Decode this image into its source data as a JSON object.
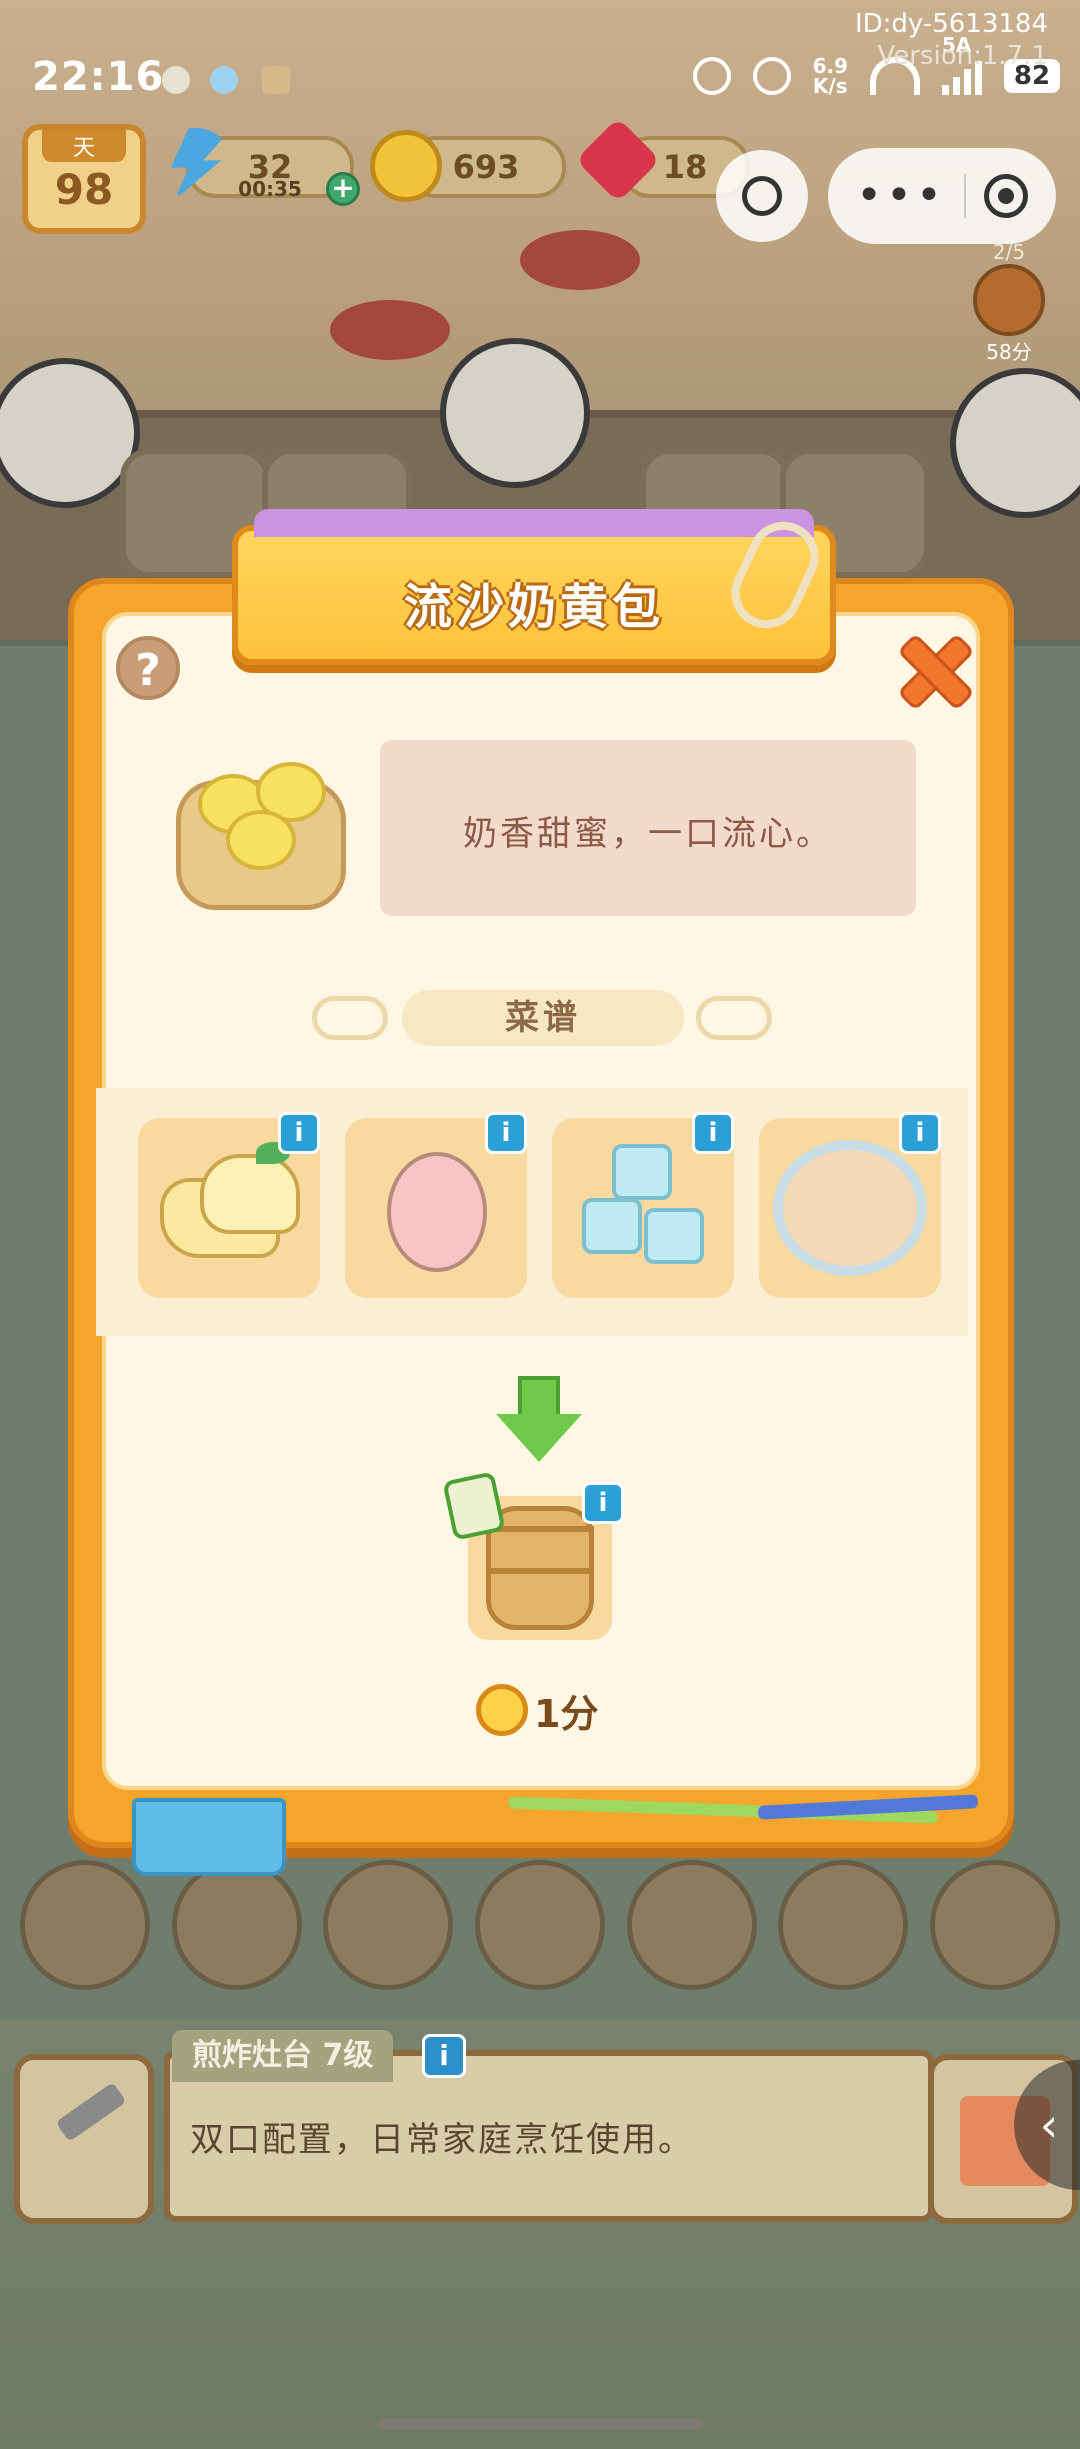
{
  "status_bar": {
    "time": "22:16",
    "network_speed_value": "6.9",
    "network_speed_unit": "K/s",
    "battery": "82",
    "signal_label": "5A"
  },
  "debug_info": {
    "id": "ID:dy-5613184",
    "version": "Version:1.7.1"
  },
  "resources": {
    "day_label": "天",
    "day_value": "98",
    "energy_value": "32",
    "energy_timer": "00:35",
    "coins": "693",
    "gems": "18"
  },
  "order_indicator": {
    "count": "2/5",
    "time": "58分"
  },
  "recipe_dialog": {
    "title": "流沙奶黄包",
    "description": "奶香甜蜜，一口流心。",
    "section_label": "菜谱",
    "help_label": "?",
    "info_label": "i",
    "ingredients": [
      {
        "icon": "butter-icon"
      },
      {
        "icon": "egg-icon"
      },
      {
        "icon": "ice-sugar-icon"
      },
      {
        "icon": "flour-bowl-icon"
      }
    ],
    "result_icon": "steamer-icon",
    "cook_time": "1分"
  },
  "station": {
    "title": "煎炸灶台 7级",
    "description": "双口配置，日常家庭烹饪使用。",
    "info_label": "i"
  },
  "colors": {
    "dialog_frame": "#f6a52c",
    "dialog_bg": "#fff7e3",
    "title_plate": "#ffc23a",
    "info_badge": "#2c9fd7",
    "close_button": "#f0762e"
  }
}
